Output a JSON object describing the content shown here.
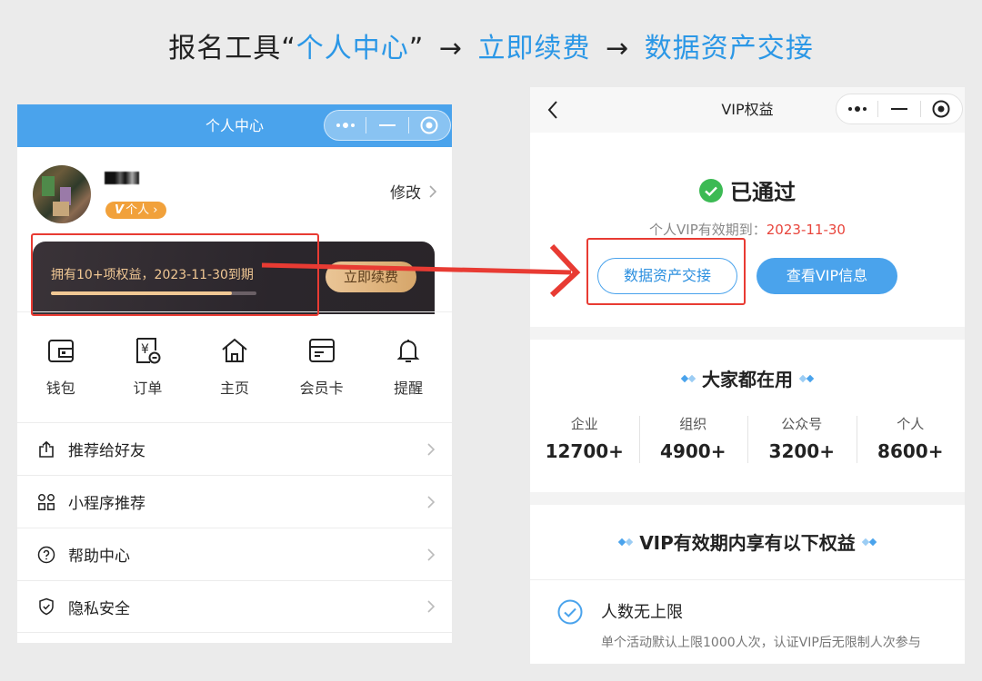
{
  "header": {
    "prefix": "报名工具“",
    "step1": "个人中心",
    "quote_close": "”",
    "arrow1": "→",
    "step2": "立即续费",
    "arrow2": "→",
    "step3": "数据资产交接"
  },
  "left_phone": {
    "nav_title": "个人中心",
    "vip_badge": {
      "v": "V",
      "label": "个人 ›"
    },
    "edit_label": "修改",
    "vip_card": {
      "text": "拥有10+项权益，2023-11-30到期",
      "progress": 0.88,
      "renew_label": "立即续费"
    },
    "grid": [
      {
        "icon": "wallet-icon",
        "label": "钱包"
      },
      {
        "icon": "order-icon",
        "label": "订单"
      },
      {
        "icon": "home-icon",
        "label": "主页"
      },
      {
        "icon": "member-card-icon",
        "label": "会员卡"
      },
      {
        "icon": "bell-icon",
        "label": "提醒"
      }
    ],
    "list": [
      {
        "icon": "share-icon",
        "label": "推荐给好友"
      },
      {
        "icon": "apps-icon",
        "label": "小程序推荐"
      },
      {
        "icon": "help-icon",
        "label": "帮助中心"
      },
      {
        "icon": "shield-icon",
        "label": "隐私安全"
      }
    ]
  },
  "right_phone": {
    "nav_title": "VIP权益",
    "status": "已通过",
    "expiry_label": "个人VIP有效期到：",
    "expiry_date": "2023-11-30",
    "btn_handover": "数据资产交接",
    "btn_view_vip": "查看VIP信息",
    "popular_title": "大家都在用",
    "stats": [
      {
        "label": "企业",
        "value": "12700+"
      },
      {
        "label": "组织",
        "value": "4900+"
      },
      {
        "label": "公众号",
        "value": "3200+"
      },
      {
        "label": "个人",
        "value": "8600+"
      }
    ],
    "benefits_title": "VIP有效期内享有以下权益",
    "benefit": {
      "title": "人数无上限",
      "desc": "单个活动默认上限1000人次，认证VIP后无限制人次参与"
    }
  },
  "colors": {
    "accent_blue": "#4aa3ec",
    "highlight_red": "#e83b33",
    "gold": "#f1c894",
    "expiry_red": "#e8453c",
    "success_green": "#3cba54"
  }
}
